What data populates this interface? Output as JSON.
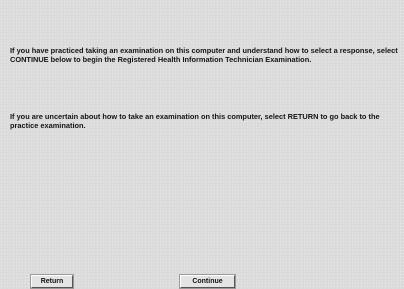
{
  "instructions": {
    "continue_message": "If you have practiced taking an examination on this computer and understand how to select a response, select CONTINUE below to begin the Registered Health Information Technician Examination.",
    "return_message": "If you are uncertain about how to take an examination on this computer, select RETURN to go back to the practice examination."
  },
  "buttons": {
    "return_label": "Return",
    "continue_label": "Continue"
  },
  "colors": {
    "background": "#dcdcdc",
    "text": "#141414"
  }
}
